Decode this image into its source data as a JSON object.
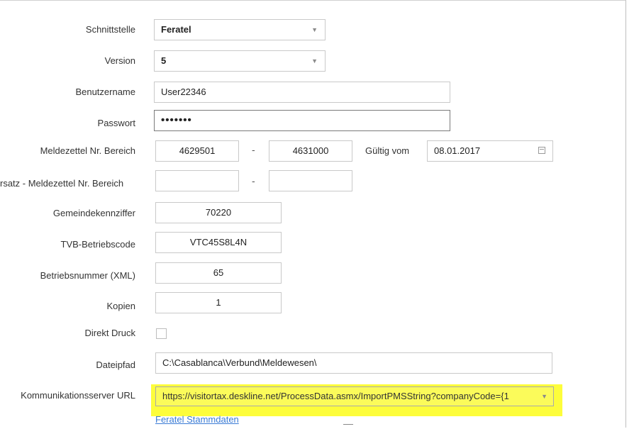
{
  "form": {
    "schnittstelle": {
      "label": "Schnittstelle",
      "value": "Feratel"
    },
    "version": {
      "label": "Version",
      "value": "5"
    },
    "benutzername": {
      "label": "Benutzername",
      "value": "User22346"
    },
    "passwort": {
      "label": "Passwort",
      "value": "•••••••"
    },
    "meldezettel": {
      "label": "Meldezettel Nr. Bereich",
      "from": "4629501",
      "separator": "-",
      "to": "4631000"
    },
    "gueltig": {
      "label": "Gültig vom",
      "value": "08.01.2017"
    },
    "ersatz": {
      "label": "rsatz - Meldezettel Nr. Bereich",
      "from": "",
      "separator": "-",
      "to": ""
    },
    "gemeindekennziffer": {
      "label": "Gemeindekennziffer",
      "value": "70220"
    },
    "tvb": {
      "label": "TVB-Betriebscode",
      "value": "VTC45S8L4N"
    },
    "betriebsnummer": {
      "label": "Betriebsnummer (XML)",
      "value": "65"
    },
    "kopien": {
      "label": "Kopien",
      "value": "1"
    },
    "direktdruck": {
      "label": "Direkt Druck",
      "checked": false
    },
    "dateipfad": {
      "label": "Dateipfad",
      "value": "C:\\Casablanca\\Verbund\\Meldewesen\\"
    },
    "kommunikationsserver": {
      "label": "Kommunikationsserver URL",
      "value": "https://visitortax.deskline.net/ProcessData.asmx/ImportPMSString?companyCode={1"
    },
    "stammdaten_link": "Feratel Stammdaten"
  },
  "icons": {
    "dropdown": "chevron-down-icon",
    "calendar": "calendar-icon"
  },
  "colors": {
    "highlight": "#fdfd3b",
    "link": "#3a7bd5"
  }
}
